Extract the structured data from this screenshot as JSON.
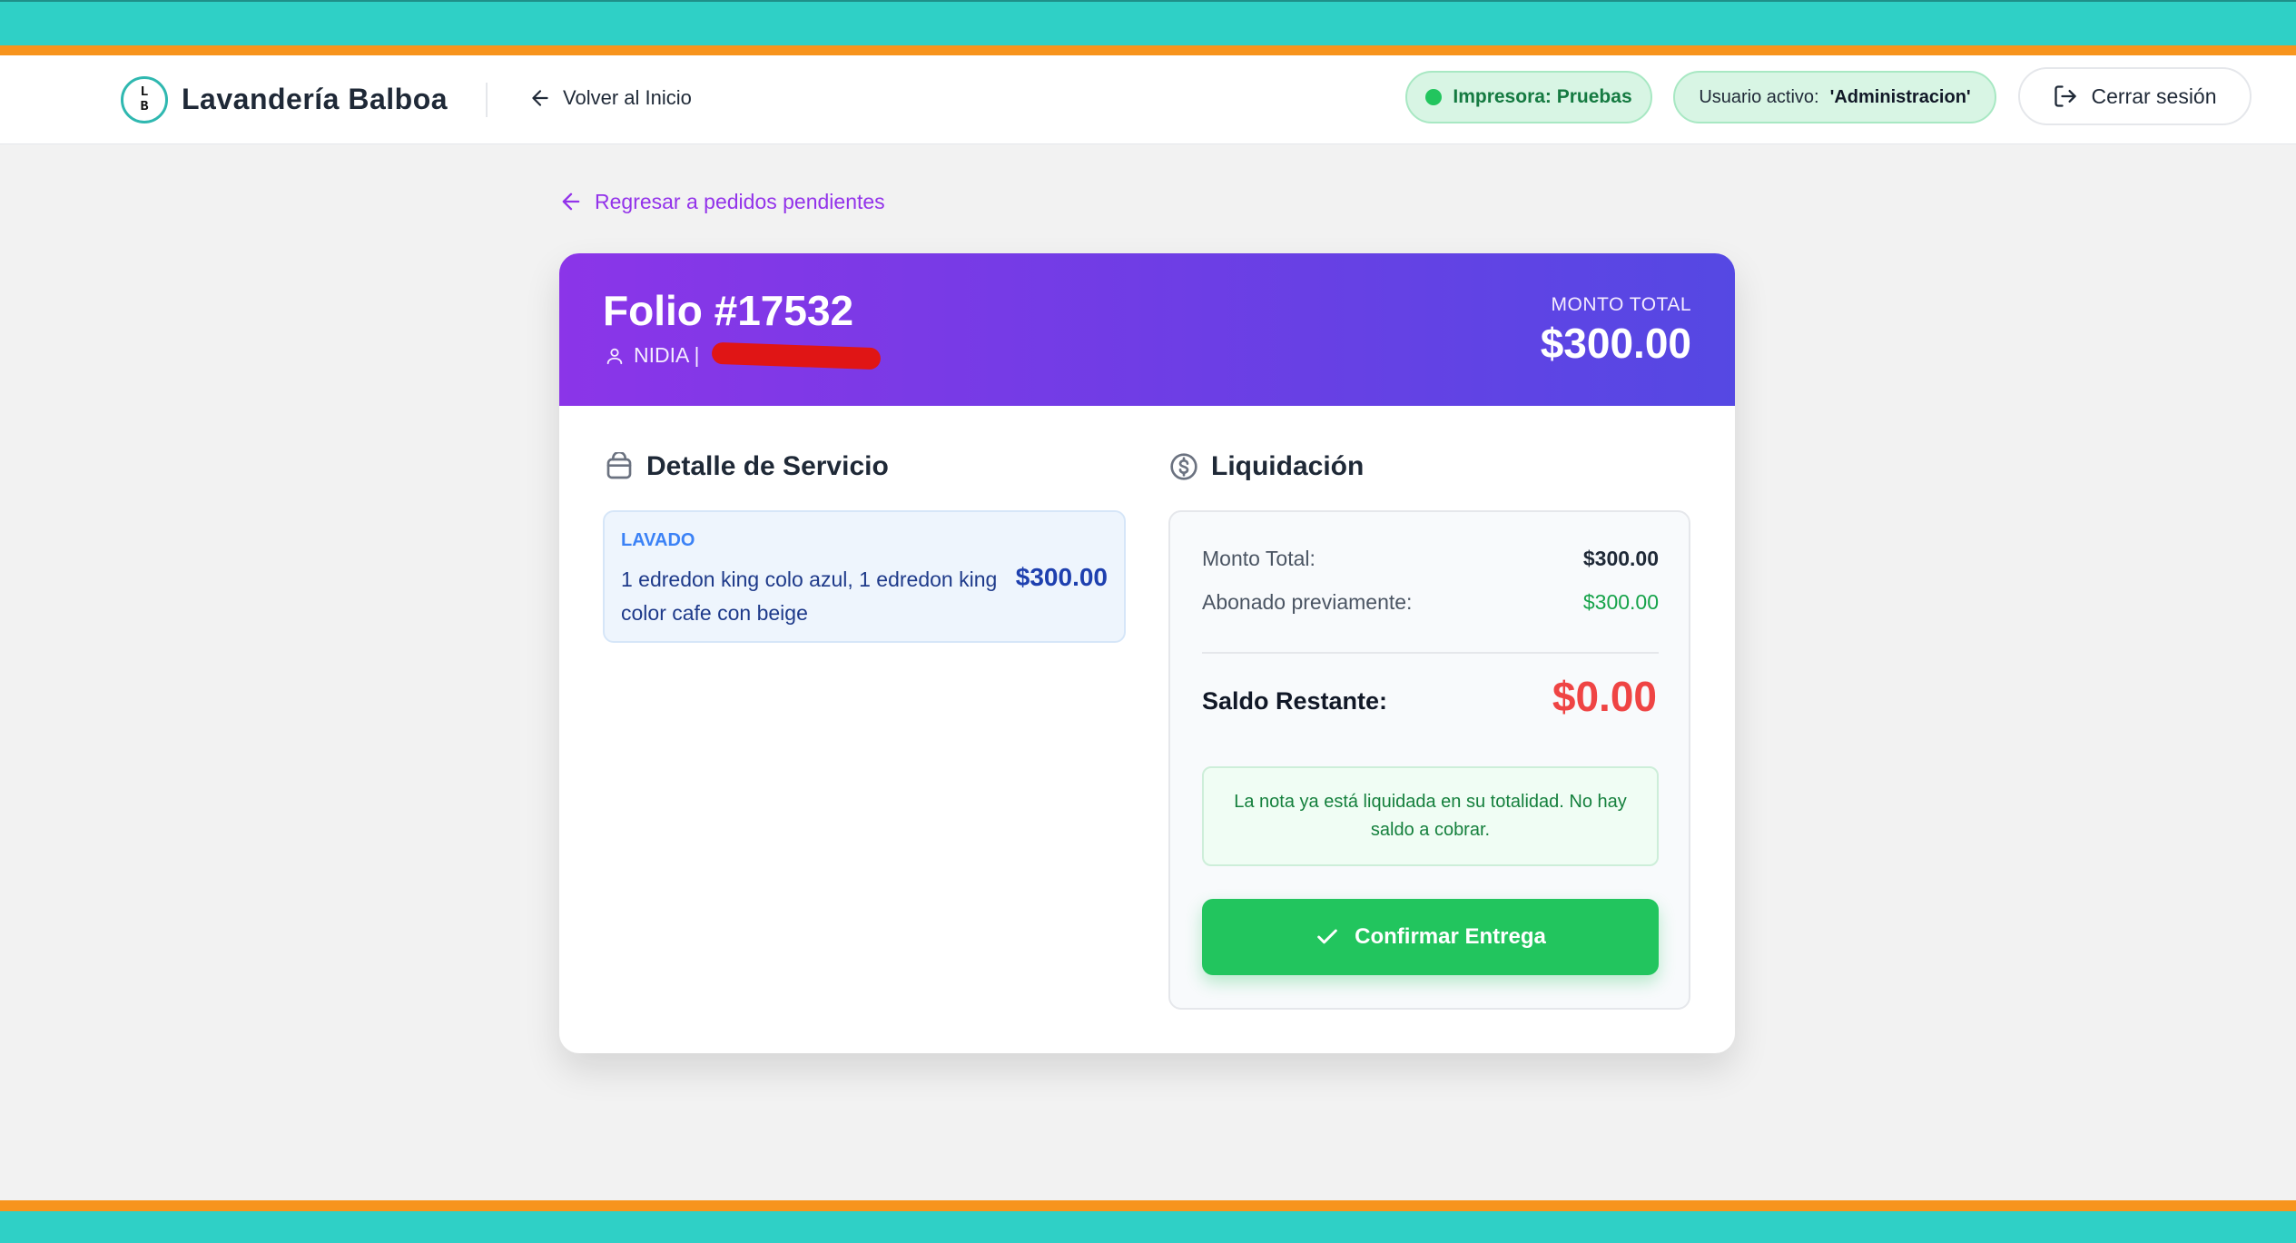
{
  "colors": {
    "teal": "#2fd0c6",
    "orange": "#f7941d",
    "purple": "#8b35e8",
    "indigo": "#5548e3",
    "green": "#22c55e",
    "red": "#ef4444"
  },
  "header": {
    "logo_letters": [
      "L",
      "B"
    ],
    "brand": "Lavandería Balboa",
    "back_home": "Volver al Inicio",
    "printer_status": "Impresora: Pruebas",
    "user_prefix": "Usuario activo:",
    "user_name": "'Administracion'",
    "logout": "Cerrar sesión"
  },
  "return_link": "Regresar a pedidos pendientes",
  "order": {
    "folio": "Folio #17532",
    "customer_name": "NIDIA |",
    "total_label": "MONTO TOTAL",
    "total_value": "$300.00"
  },
  "detail": {
    "title": "Detalle de Servicio",
    "items": [
      {
        "type": "LAVADO",
        "description": "1 edredon king colo azul, 1 edredon king color cafe con beige",
        "price": "$300.00"
      }
    ]
  },
  "liquidation": {
    "title": "Liquidación",
    "monto_total_label": "Monto Total:",
    "monto_total_value": "$300.00",
    "abonado_label": "Abonado previamente:",
    "abonado_value": "$300.00",
    "saldo_label": "Saldo Restante:",
    "saldo_value": "$0.00",
    "note": "La nota ya está liquidada en su totalidad. No hay saldo a cobrar.",
    "confirm_button": "Confirmar Entrega"
  },
  "icons": [
    "arrow-left-icon",
    "logout-icon",
    "user-icon",
    "basket-icon",
    "dollar-circle-icon",
    "check-icon"
  ]
}
